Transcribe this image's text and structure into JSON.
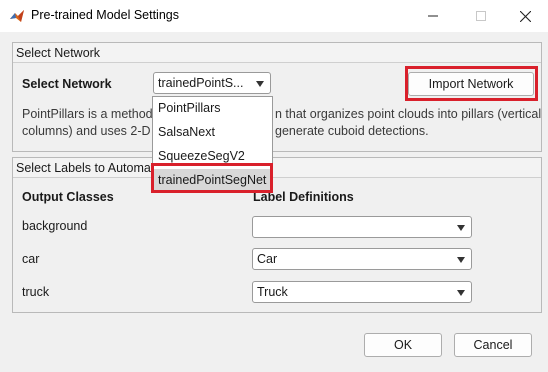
{
  "window": {
    "title": "Pre-trained Model Settings",
    "icon": "matlab-icon",
    "controls": [
      "minimize-icon",
      "maximize-icon",
      "close-icon"
    ]
  },
  "select_network_panel": {
    "heading": "Select Network",
    "label": "Select Network",
    "selected_value": "trainedPointS...",
    "import_button": "Import Network",
    "description_left_1": "PointPillars is a method f",
    "description_right_1": "n that organizes point clouds into pillars (vertical",
    "description_left_2": "columns) and uses 2-D c",
    "description_right_2": "generate cuboid detections."
  },
  "network_dropdown_menu": {
    "options": [
      "PointPillars",
      "SalsaNext",
      "SqueezeSegV2",
      "trainedPointSegNet"
    ],
    "highlighted_index": 3
  },
  "labels_panel": {
    "heading": "Select Labels to Automate",
    "col_output_classes": "Output Classes",
    "col_label_definitions": "Label Definitions",
    "rows": [
      {
        "output_class": "background",
        "label_definition": ""
      },
      {
        "output_class": "car",
        "label_definition": "Car"
      },
      {
        "output_class": "truck",
        "label_definition": "Truck"
      }
    ]
  },
  "footer": {
    "ok_label": "OK",
    "cancel_label": "Cancel"
  },
  "colors": {
    "highlight_border": "#d9202b",
    "background": "#f0f0f0",
    "menu_selected": "#d8d8d8"
  }
}
